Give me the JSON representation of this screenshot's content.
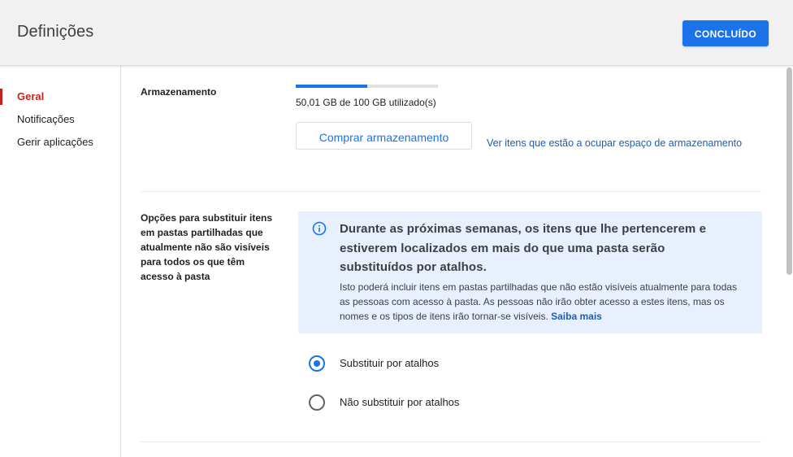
{
  "window": {
    "title": "Definições",
    "done_label": "CONCLUÍDO"
  },
  "sidebar": {
    "items": [
      {
        "label": "Geral",
        "active": true
      },
      {
        "label": "Notificações",
        "active": false
      },
      {
        "label": "Gerir aplicações",
        "active": false
      }
    ]
  },
  "storage": {
    "label": "Armazenamento",
    "usage_text": "50,01 GB de 100 GB utilizado(s)",
    "used_fraction": 0.5001,
    "buy_label": "Comprar armazenamento",
    "view_items_link": "Ver itens que estão a ocupar espaço de armazenamento"
  },
  "replace_options": {
    "label": "Opções para substituir itens em pastas partilhadas que atualmente não são visíveis para todos os que têm acesso à pasta",
    "info": {
      "icon": "info-icon",
      "heading": "Durante as próximas semanas, os itens que lhe pertencerem e estiverem localizados em mais do que uma pasta serão substituídos por atalhos.",
      "body": "Isto poderá incluir itens em pastas partilhadas que não estão visíveis atualmente para todas as pessoas com acesso à pasta. As pessoas não irão obter acesso a estes itens, mas os nomes e os tipos de itens irão tornar-se visíveis.",
      "learn_more": "Saiba mais"
    },
    "options": [
      {
        "label": "Substituir por atalhos",
        "selected": true
      },
      {
        "label": "Não substituir por atalhos",
        "selected": false
      }
    ]
  },
  "colors": {
    "accent": "#1a73e8",
    "active_nav": "#c5221f",
    "info_bg": "#e8f0fe",
    "link": "#1a5fb4"
  }
}
